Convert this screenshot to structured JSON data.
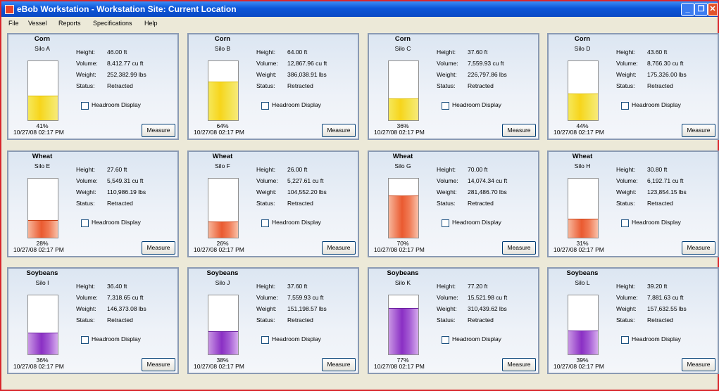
{
  "window": {
    "title": "eBob Workstation - Workstation Site: Current Location",
    "accent_color": "#0c55d8",
    "buttons": {
      "minimize": "_",
      "maximize": "❐",
      "close": "✕"
    }
  },
  "menu": [
    "File",
    "Vessel",
    "Reports",
    "Specifications",
    "Help"
  ],
  "labels": {
    "height": "Height:",
    "volume": "Volume:",
    "weight": "Weight:",
    "status": "Status:",
    "headroom": "Headroom Display",
    "measure": "Measure"
  },
  "fill_colors": {
    "corn": "#f7d51c",
    "wheat": "#ea5a30",
    "soy": "#8a2fc4"
  },
  "silos": [
    {
      "crop": "Corn",
      "silo": "Silo A",
      "height": "46.00 ft",
      "volume": "8,412.77 cu ft",
      "weight": "252,382.99 lbs",
      "status": "Retracted",
      "percent_label": "41%",
      "fill_fraction": 0.41,
      "crop_type": "corn",
      "timestamp": "10/27/08 02:17 PM"
    },
    {
      "crop": "Corn",
      "silo": "Silo B",
      "height": "64.00 ft",
      "volume": "12,867.96 cu ft",
      "weight": "386,038.91 lbs",
      "status": "Retracted",
      "percent_label": "64%",
      "fill_fraction": 0.64,
      "crop_type": "corn",
      "timestamp": "10/27/08 02:17 PM"
    },
    {
      "crop": "Corn",
      "silo": "Silo C",
      "height": "37.60 ft",
      "volume": "7,559.93 cu ft",
      "weight": "226,797.86 lbs",
      "status": "Retracted",
      "percent_label": "36%",
      "fill_fraction": 0.36,
      "crop_type": "corn",
      "timestamp": "10/27/08 02:17 PM"
    },
    {
      "crop": "Corn",
      "silo": "Silo D",
      "height": "43.60 ft",
      "volume": "8,766.30 cu ft",
      "weight": "175,326.00 lbs",
      "status": "Retracted",
      "percent_label": "44%",
      "fill_fraction": 0.44,
      "crop_type": "corn",
      "timestamp": "10/27/08 02:17 PM"
    },
    {
      "crop": "Wheat",
      "silo": "Silo E",
      "height": "27.60 ft",
      "volume": "5,549.31 cu ft",
      "weight": "110,986.19 lbs",
      "status": "Retracted",
      "percent_label": "28%",
      "fill_fraction": 0.28,
      "crop_type": "wheat",
      "timestamp": "10/27/08 02:17 PM"
    },
    {
      "crop": "Wheat",
      "silo": "Silo F",
      "height": "26.00 ft",
      "volume": "5,227.61 cu ft",
      "weight": "104,552.20 lbs",
      "status": "Retracted",
      "percent_label": "26%",
      "fill_fraction": 0.26,
      "crop_type": "wheat",
      "timestamp": "10/27/08 02:17 PM"
    },
    {
      "crop": "Wheat",
      "silo": "Silo G",
      "height": "70.00 ft",
      "volume": "14,074.34 cu ft",
      "weight": "281,486.70 lbs",
      "status": "Retracted",
      "percent_label": "70%",
      "fill_fraction": 0.7,
      "crop_type": "wheat",
      "timestamp": "10/27/08 02:17 PM"
    },
    {
      "crop": "Wheat",
      "silo": "Silo H",
      "height": "30.80 ft",
      "volume": "6,192.71 cu ft",
      "weight": "123,854.15 lbs",
      "status": "Retracted",
      "percent_label": "31%",
      "fill_fraction": 0.31,
      "crop_type": "wheat",
      "timestamp": "10/27/08 02:17 PM"
    },
    {
      "crop": "Soybeans",
      "silo": "Silo I",
      "height": "36.40 ft",
      "volume": "7,318.65 cu ft",
      "weight": "146,373.08 lbs",
      "status": "Retracted",
      "percent_label": "36%",
      "fill_fraction": 0.36,
      "crop_type": "soy",
      "timestamp": "10/27/08 02:17 PM"
    },
    {
      "crop": "Soybeans",
      "silo": "Silo J",
      "height": "37.60 ft",
      "volume": "7,559.93 cu ft",
      "weight": "151,198.57 lbs",
      "status": "Retracted",
      "percent_label": "38%",
      "fill_fraction": 0.38,
      "crop_type": "soy",
      "timestamp": "10/27/08 02:17 PM"
    },
    {
      "crop": "Soybeans",
      "silo": "Silo K",
      "height": "77.20 ft",
      "volume": "15,521.98 cu ft",
      "weight": "310,439.62 lbs",
      "status": "Retracted",
      "percent_label": "77%",
      "fill_fraction": 0.77,
      "crop_type": "soy",
      "timestamp": "10/27/08 02:17 PM"
    },
    {
      "crop": "Soybeans",
      "silo": "Silo L",
      "height": "39.20 ft",
      "volume": "7,881.63 cu ft",
      "weight": "157,632.55 lbs",
      "status": "Retracted",
      "percent_label": "39%",
      "fill_fraction": 0.39,
      "crop_type": "soy",
      "timestamp": "10/27/08 02:17 PM"
    }
  ]
}
